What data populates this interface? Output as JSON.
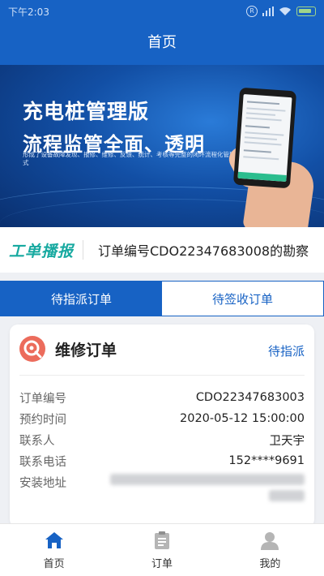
{
  "status_bar": {
    "time": "下午2:03"
  },
  "header": {
    "title": "首页"
  },
  "banner": {
    "title_line1": "充电桩管理版",
    "title_line2": "流程监管全面、透明",
    "description": "形成了设备故障发现、报修、维修、反馈、统计、考核等完整的闭环流程化管理模式"
  },
  "ticker": {
    "tag": "工单播报",
    "message": "订单编号CDO22347683008的勘察"
  },
  "tabs": [
    {
      "label": "待指派订单",
      "active": true
    },
    {
      "label": "待签收订单",
      "active": false
    }
  ],
  "order_card": {
    "title": "维修订单",
    "status": "待指派",
    "fields": {
      "order_no": {
        "label": "订单编号",
        "value": "CDO22347683003"
      },
      "appointment": {
        "label": "预约时间",
        "value": "2020-05-12 15:00:00"
      },
      "contact": {
        "label": "联系人",
        "value": "卫天宇"
      },
      "phone": {
        "label": "联系电话",
        "value": "152****9691"
      },
      "address": {
        "label": "安装地址"
      }
    }
  },
  "bottom_nav": [
    {
      "label": "首页",
      "icon": "home-icon",
      "active": true
    },
    {
      "label": "订单",
      "icon": "clipboard-icon",
      "active": false
    },
    {
      "label": "我的",
      "icon": "user-icon",
      "active": false
    }
  ],
  "colors": {
    "primary": "#1762c4",
    "ticker_tag": "#17a9a0",
    "order_icon": "#ec6c5c",
    "nav_active": "#1762c4",
    "nav_inactive": "#b5b5b5"
  }
}
